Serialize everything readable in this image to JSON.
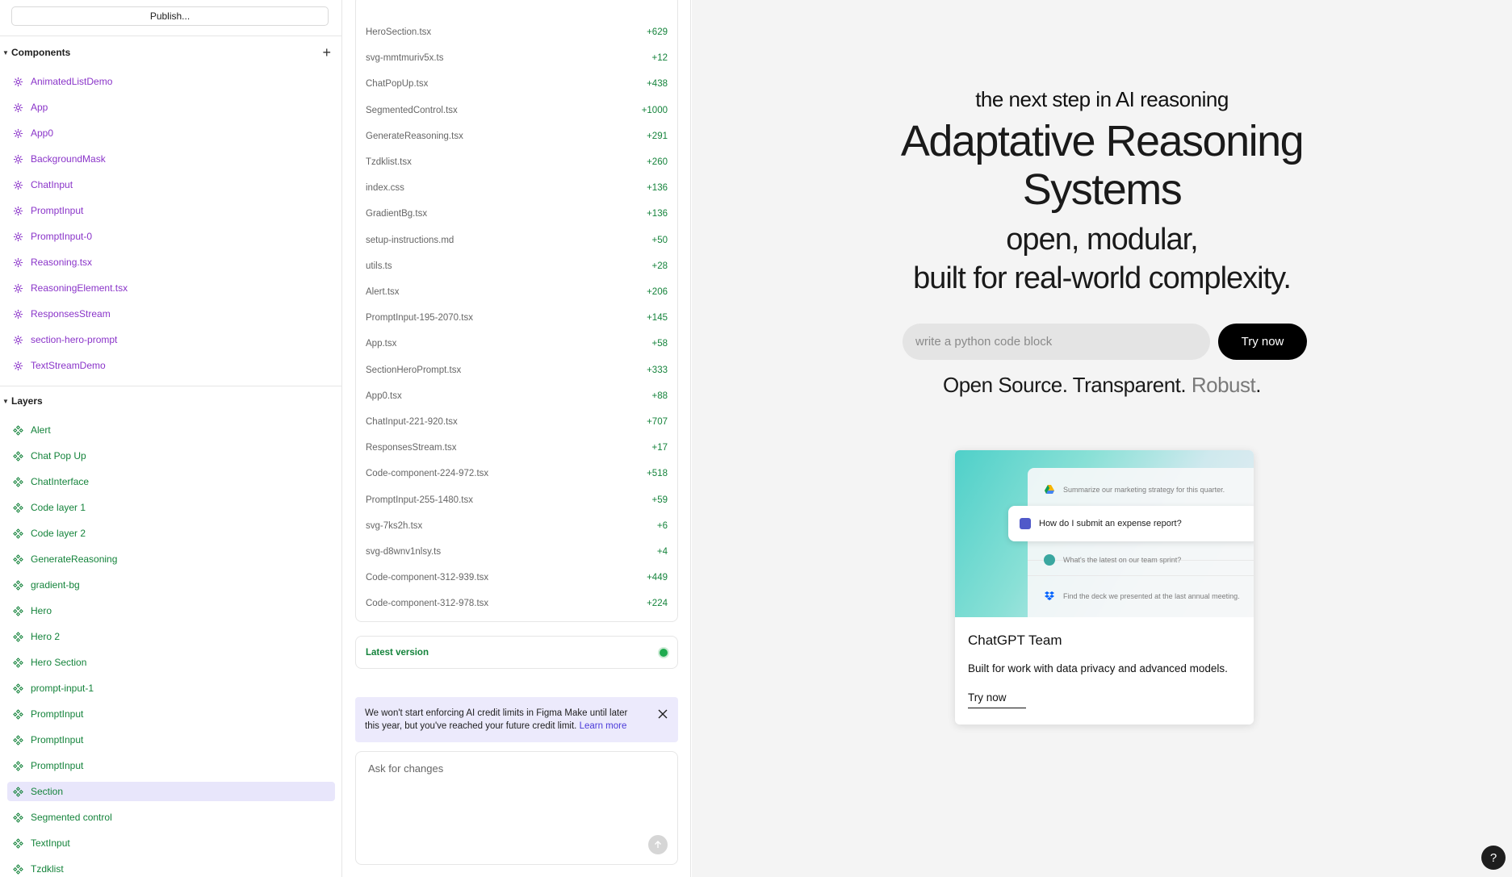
{
  "left": {
    "publish_label": "Publish...",
    "components_title": "Components",
    "components": [
      "AnimatedListDemo",
      "App",
      "App0",
      "BackgroundMask",
      "ChatInput",
      "PromptInput",
      "PromptInput-0",
      "Reasoning.tsx",
      "ReasoningElement.tsx",
      "ResponsesStream",
      "section-hero-prompt",
      "TextStreamDemo"
    ],
    "layers_title": "Layers",
    "layers": [
      "Alert",
      "Chat Pop Up",
      "ChatInterface",
      "Code layer 1",
      "Code layer 2",
      "GenerateReasoning",
      "gradient-bg",
      "Hero",
      "Hero 2",
      "Hero Section",
      "prompt-input-1",
      "PromptInput",
      "PromptInput",
      "PromptInput",
      "Section",
      "Segmented control",
      "TextInput",
      "Tzdklist"
    ],
    "selected_layer": "Section"
  },
  "mid": {
    "files": [
      {
        "name": "HeroSection.tsx",
        "change": "+629"
      },
      {
        "name": "svg-mmtmuriv5x.ts",
        "change": "+12"
      },
      {
        "name": "ChatPopUp.tsx",
        "change": "+438"
      },
      {
        "name": "SegmentedControl.tsx",
        "change": "+1000"
      },
      {
        "name": "GenerateReasoning.tsx",
        "change": "+291"
      },
      {
        "name": "Tzdklist.tsx",
        "change": "+260"
      },
      {
        "name": "index.css",
        "change": "+136"
      },
      {
        "name": "GradientBg.tsx",
        "change": "+136"
      },
      {
        "name": "setup-instructions.md",
        "change": "+50"
      },
      {
        "name": "utils.ts",
        "change": "+28"
      },
      {
        "name": "Alert.tsx",
        "change": "+206"
      },
      {
        "name": "PromptInput-195-2070.tsx",
        "change": "+145"
      },
      {
        "name": "App.tsx",
        "change": "+58"
      },
      {
        "name": "SectionHeroPrompt.tsx",
        "change": "+333"
      },
      {
        "name": "App0.tsx",
        "change": "+88"
      },
      {
        "name": "ChatInput-221-920.tsx",
        "change": "+707"
      },
      {
        "name": "ResponsesStream.tsx",
        "change": "+17"
      },
      {
        "name": "Code-component-224-972.tsx",
        "change": "+518"
      },
      {
        "name": "PromptInput-255-1480.tsx",
        "change": "+59"
      },
      {
        "name": "svg-7ks2h.tsx",
        "change": "+6"
      },
      {
        "name": "svg-d8wnv1nlsy.ts",
        "change": "+4"
      },
      {
        "name": "Code-component-312-939.tsx",
        "change": "+449"
      },
      {
        "name": "Code-component-312-978.tsx",
        "change": "+224"
      }
    ],
    "version_label": "Latest version",
    "notice_text": "We won't start enforcing AI credit limits in Figma Make until later this year, but you've reached your future credit limit.",
    "notice_link": "Learn more",
    "ask_placeholder": "Ask for changes"
  },
  "preview": {
    "kicker": "the next step in AI reasoning",
    "title_line1": "Adaptative Reasoning",
    "title_line2": "Systems",
    "sub_line1": "open, modular,",
    "sub_line2": "built for real-world complexity.",
    "prompt_placeholder": "write a python code block",
    "try_label": "Try now",
    "tagline_a": "Open Source. Transparent.",
    "tagline_b": "Robust",
    "tagline_c": ".",
    "card": {
      "items": [
        "Summarize our marketing strategy for this quarter.",
        "How do I submit an expense report?",
        "What's the latest on our team sprint?",
        "Find the deck we presented at the last annual meeting."
      ],
      "title": "ChatGPT Team",
      "desc": "Built for work with data privacy and advanced models.",
      "link": "Try now"
    },
    "help_label": "?"
  },
  "colors": {
    "component": "#8a34c9",
    "layer": "#14833b",
    "selected_bg": "#e8e6fb",
    "preview_bg": "#f4f4f4"
  }
}
